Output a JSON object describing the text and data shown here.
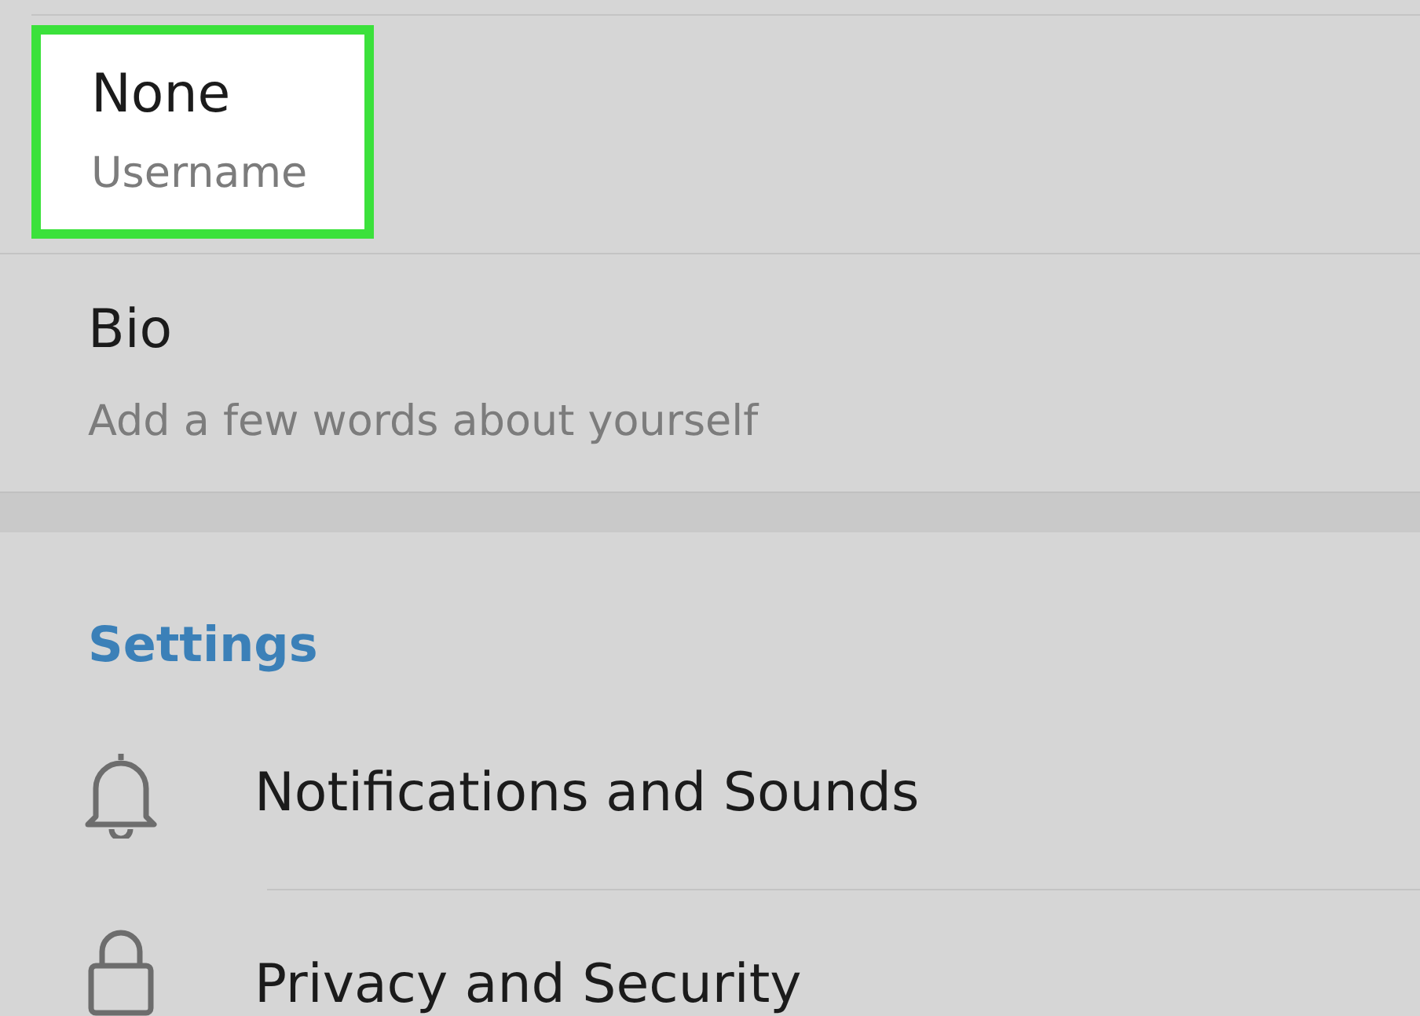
{
  "profile_items": [
    {
      "value": "None",
      "label": "Username",
      "highlighted": true
    },
    {
      "value": "Bio",
      "label": "Add a few words about yourself",
      "highlighted": false
    }
  ],
  "settings": {
    "heading": "Settings",
    "items": [
      {
        "kind": "bell",
        "label": "Notifications and Sounds"
      },
      {
        "kind": "lock",
        "label": "Privacy and Security"
      }
    ]
  }
}
